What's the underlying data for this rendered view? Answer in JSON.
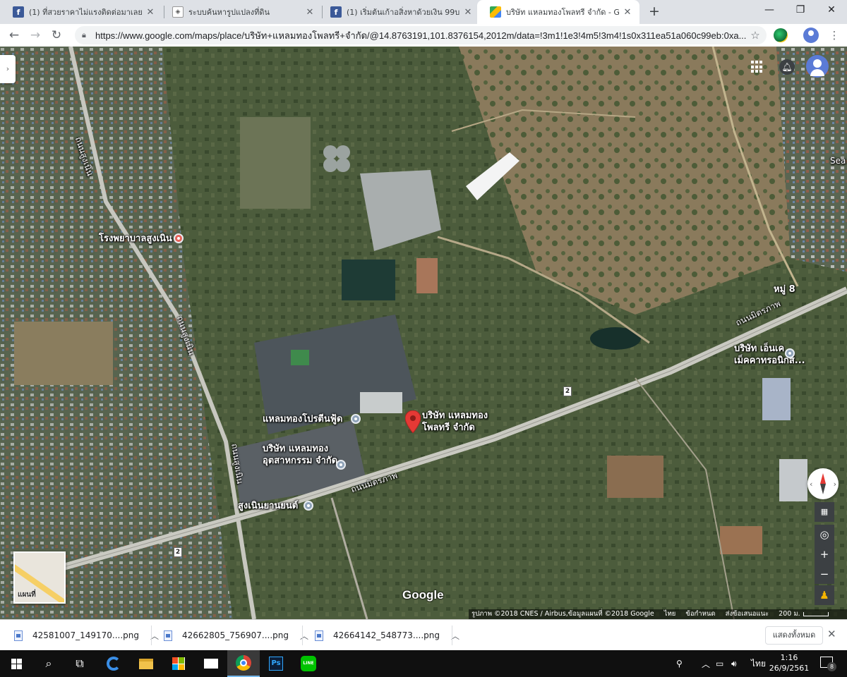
{
  "browser": {
    "tabs": [
      {
        "title": "(1) ที่สวยราคาไม่แรงติดต่อมาเลยค่ะ - ",
        "favicon": "facebook-icon"
      },
      {
        "title": "ระบบค้นหารูปแปลงที่ดิน",
        "favicon": "land-search-icon"
      },
      {
        "title": "(1) เริ่มต้นเก้าอสิ่งหาด้วยเงิน 99บาทกับ",
        "favicon": "facebook-icon"
      },
      {
        "title": "บริษัท แหลมทองโพลทรี จำกัด - Google",
        "favicon": "google-maps-icon",
        "active": true
      }
    ],
    "url": "https://www.google.com/maps/place/บริษัท+แหลมทองโพลทรี+จำกัด/@14.8763191,101.8376154,2012m/data=!3m1!1e3!4m5!3m4!1s0x311ea51a060c99eb:0xa..."
  },
  "map": {
    "labels": {
      "hospital": "โรงพยาบาลสูงเนิน",
      "road_left_top": "ถนนสูงเนิน",
      "road_left_mid": "ถนนสูงเนิน",
      "road_left_low": "ถนนสูงเนิน",
      "mittraphap_upper": "ถนนมิตรภาพ",
      "mittraphap_lower": "ถนนมิตรภาพ",
      "village": "หมู่ 8",
      "protein_food": "แหลมทองโปรตีนฟู้ด",
      "industry_line1": "บริษัท แหลมทอง",
      "industry_line2": "อุตสาหกรรม จำกัด",
      "poultry_line1": "บริษัท แหลมทอง",
      "poultry_line2": "โพลทรี จำกัด",
      "car_dealer": "สูงเนินยานยนต์",
      "mechatronics_line1": "บริษัท เอ็นเค",
      "mechatronics_line2": "เม็คคาทรอนิกส์...",
      "edge_sea": "Sea",
      "route_shield_1": "2",
      "route_shield_2": "2",
      "google_logo": "Google"
    },
    "minimap_label": "แผนที่",
    "attribution": {
      "imagery": "รูปภาพ ©2018 CNES / Airbus,ข้อมูลแผนที่ ©2018 Google",
      "lang": "ไทย",
      "terms": "ข้อกำหนด",
      "feedback": "ส่งข้อเสนอแนะ",
      "scale": "200 ม."
    }
  },
  "downloads": {
    "items": [
      {
        "name": "42581007_149170....png"
      },
      {
        "name": "42662805_756907....png"
      },
      {
        "name": "42664142_548773....png"
      }
    ],
    "show_all": "แสดงทั้งหมด"
  },
  "taskbar": {
    "lang": "ไทย",
    "time": "1:16",
    "date": "26/9/2561",
    "notifications": "8"
  }
}
